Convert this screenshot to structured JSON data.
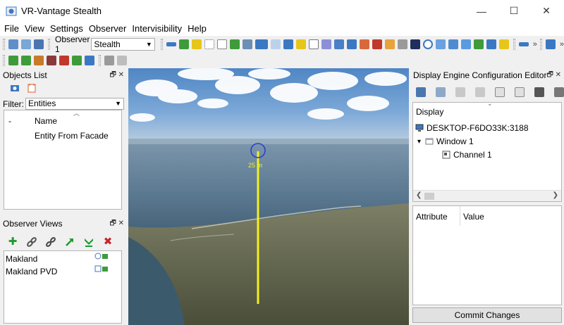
{
  "window": {
    "title": "VR-Vantage Stealth",
    "controls": {
      "minimize": "—",
      "maximize": "☐",
      "close": "✕"
    }
  },
  "menubar": [
    "File",
    "View",
    "Settings",
    "Observer",
    "Intervisibility",
    "Help"
  ],
  "toolbar": {
    "observer_label": "Observer 1",
    "observer_value": "Stealth",
    "overflow": "»"
  },
  "objects_list": {
    "title": "Objects List",
    "filter_label": "Filter:",
    "filter_value": "Entities",
    "columns": [
      "-",
      "Name"
    ],
    "rows": [
      "Entity From Facade"
    ]
  },
  "observer_views": {
    "title": "Observer Views",
    "items": [
      "Makland",
      "Makland PVD"
    ]
  },
  "viewport": {
    "range_label": "25 m"
  },
  "dec": {
    "title": "Display Engine Configuration Editor",
    "tree_header": "Display",
    "nodes": [
      "DESKTOP-F6DO33K:3188",
      "Window 1",
      "Channel 1"
    ],
    "attr_columns": [
      "Attribute",
      "Value"
    ],
    "commit_label": "Commit Changes"
  },
  "icons": {
    "panel_float": "🗗",
    "panel_close": "✕",
    "expand": "⌄",
    "add": "✚",
    "delete": "✖"
  },
  "colors": {
    "marker_line": "#f3f01e",
    "marker_circle": "#2c3fd0",
    "add_icon": "#1e9b2b",
    "delete_icon": "#c5262a",
    "toolbar_blue": "#3b78c2",
    "toolbar_green": "#3f9b3a",
    "toolbar_yellow": "#e6c619"
  }
}
